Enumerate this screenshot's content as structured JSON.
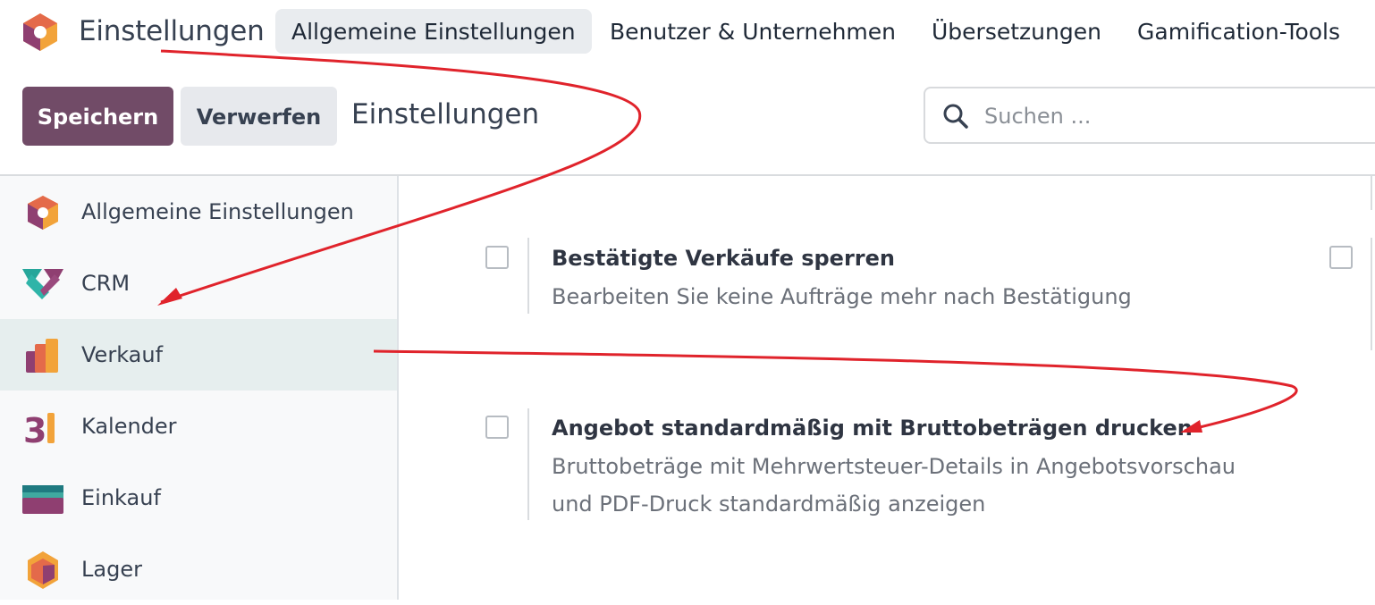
{
  "topbar": {
    "app_title": "Einstellungen",
    "menu": [
      {
        "label": "Allgemeine Einstellungen",
        "active": true
      },
      {
        "label": "Benutzer & Unternehmen",
        "active": false
      },
      {
        "label": "Übersetzungen",
        "active": false
      },
      {
        "label": "Gamification-Tools",
        "active": false
      }
    ]
  },
  "control": {
    "save_label": "Speichern",
    "discard_label": "Verwerfen",
    "breadcrumb": "Einstellungen",
    "search_placeholder": "Suchen ..."
  },
  "sidebar": {
    "items": [
      {
        "label": "Allgemeine Einstellungen",
        "icon": "odoo-settings-icon",
        "active": false
      },
      {
        "label": "CRM",
        "icon": "crm-handshake-icon",
        "active": false
      },
      {
        "label": "Verkauf",
        "icon": "sales-chart-icon",
        "active": true
      },
      {
        "label": "Kalender",
        "icon": "calendar-31-icon",
        "active": false
      },
      {
        "label": "Einkauf",
        "icon": "purchase-card-icon",
        "active": false
      },
      {
        "label": "Lager",
        "icon": "inventory-box-icon",
        "active": false
      }
    ]
  },
  "settings": [
    {
      "title": "Bestätigte Verkäufe sperren",
      "description": [
        "Bearbeiten Sie keine Aufträge mehr nach Bestätigung"
      ],
      "checked": false
    },
    {
      "title": "Angebot standardmäßig mit Bruttobeträgen drucken",
      "description": [
        "Bruttobeträge mit Mehrwertsteuer-Details in Angebotsvorschau",
        "und PDF-Druck standardmäßig anzeigen"
      ],
      "checked": false
    }
  ],
  "colors": {
    "brand": "#714b67",
    "annotation_arrow": "#e0232b",
    "active_sidebar": "#e6eeee"
  }
}
